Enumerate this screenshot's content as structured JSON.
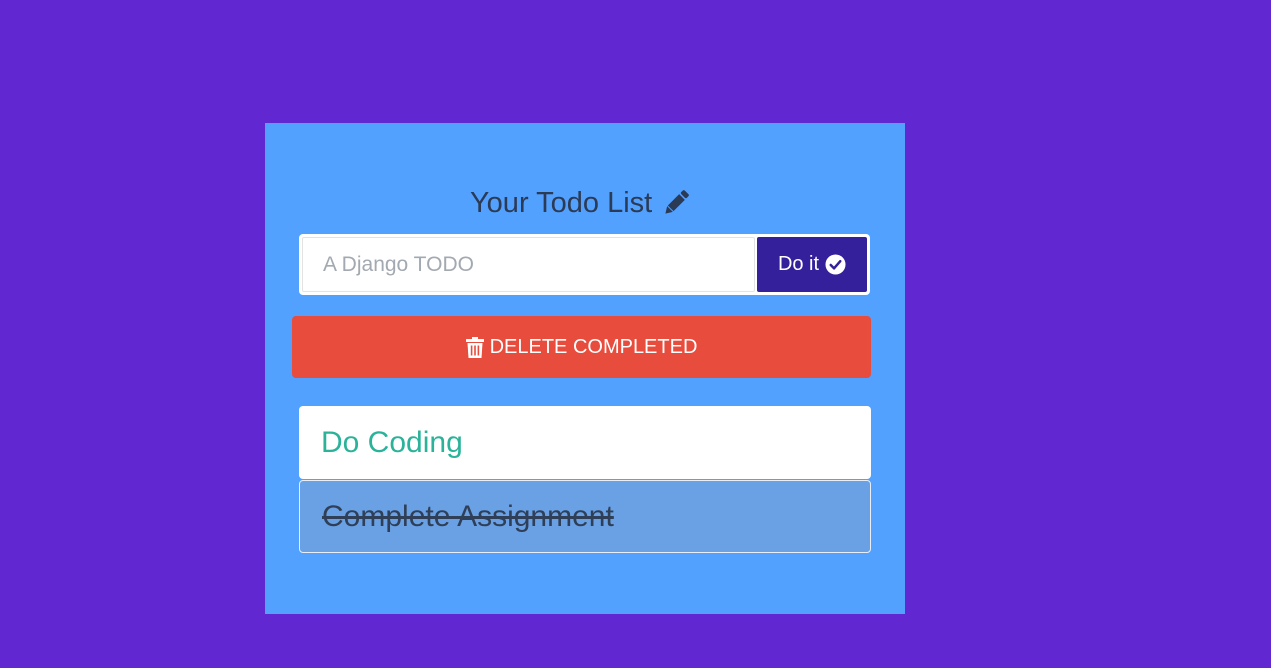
{
  "header": {
    "title": "Your Todo List",
    "icon": "pencil-icon"
  },
  "form": {
    "placeholder": "A Django TODO",
    "value": "",
    "submit_label": "Do it",
    "submit_icon": "check-circle-icon"
  },
  "actions": {
    "delete_completed_label": "DELETE COMPLETED",
    "delete_icon": "trash-icon"
  },
  "todos": [
    {
      "text": "Do Coding",
      "completed": false
    },
    {
      "text": "Complete Assignment",
      "completed": true
    }
  ],
  "colors": {
    "background": "#6127d1",
    "card": "#53a1fe",
    "title_text": "#2b3a55",
    "submit_button": "#33209a",
    "delete_button": "#e74c3c",
    "active_todo_text": "#2bb39a",
    "completed_todo_bg": "#69a1e4",
    "completed_todo_text": "#2e3f57"
  }
}
